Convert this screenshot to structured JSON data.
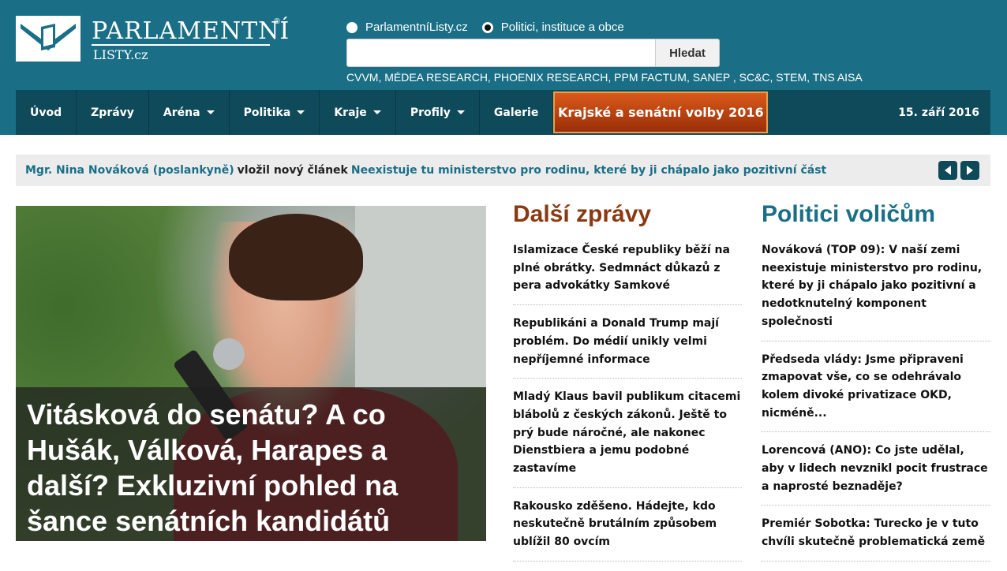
{
  "header": {
    "logo": {
      "title": "PARLAMENTNÍ",
      "subtitle": "LISTY.cz",
      "registered": "®"
    },
    "search": {
      "options": [
        {
          "label": "ParlamentníListy.cz",
          "selected": false
        },
        {
          "label": "Politici, instituce a obce",
          "selected": true
        }
      ],
      "placeholder": "",
      "button_label": "Hledat"
    },
    "sources": "CVVM, MÉDEA RESEARCH, PHOENIX RESEARCH, PPM FACTUM, SANEP , SC&C, STEM, TNS AISA"
  },
  "nav": {
    "items": [
      {
        "label": "Úvod",
        "dropdown": false
      },
      {
        "label": "Zprávy",
        "dropdown": false
      },
      {
        "label": "Aréna",
        "dropdown": true
      },
      {
        "label": "Politika",
        "dropdown": true
      },
      {
        "label": "Kraje",
        "dropdown": true
      },
      {
        "label": "Profily",
        "dropdown": true
      },
      {
        "label": "Galerie",
        "dropdown": false
      }
    ],
    "election_banner": "Krajské a senátní volby 2016",
    "date": "15. září 2016"
  },
  "ticker": {
    "author": "Mgr. Nina Nováková (poslankyně)",
    "action": "vložil nový článek",
    "article": "Neexistuje tu ministerstvo pro rodinu, které by ji chápalo jako pozitivní část"
  },
  "hero": {
    "title": "Vitásková do senátu? A co Hušák, Válková, Harapes a další? Exkluzivní pohled na šance senátních kandidátů"
  },
  "news": {
    "heading": "Další zprávy",
    "items": [
      "Islamizace České republiky běží na plné obrátky. Sedmnáct důkazů z pera advokátky Samkové",
      "Republikáni a Donald Trump mají problém. Do médií unikly velmi nepříjemné informace",
      "Mladý Klaus bavil publikum citacemi blábolů z českých zákonů. Ještě to prý bude náročné, ale nakonec Dienstbiera a jemu podobné zastavíme",
      "Rakousko zděšeno. Hádejte, kdo neskutečně brutálním způsobem ublížil 80 ovcím"
    ]
  },
  "politicians": {
    "heading": "Politici voličům",
    "items": [
      "Nováková (TOP 09): V naší zemi neexistuje ministerstvo pro rodinu, které by ji chápalo jako pozitivní a nedotknutelný komponent společnosti",
      "Předseda vlády: Jsme připraveni zmapovat vše, co se odehrávalo kolem divoké privatizace OKD, nicméně...",
      "Lorencová (ANO): Co jste udělal, aby v lidech nevznikl pocit frustrace a naprosté beznaděje?",
      "Premiér Sobotka: Turecko je v tuto chvíli skutečně problematická země"
    ]
  }
}
